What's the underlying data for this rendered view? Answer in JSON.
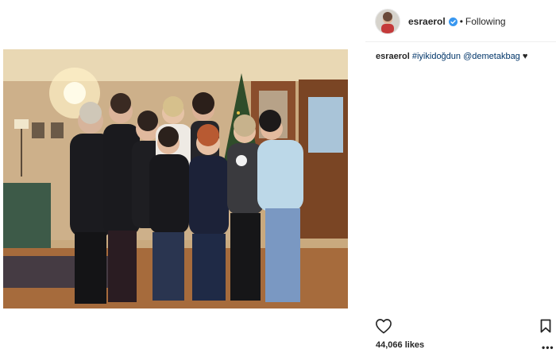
{
  "post": {
    "image_alt": "Group photo of nine women in a living room with a Christmas tree",
    "author": {
      "username": "esraerol",
      "verified": true,
      "follow_status": "Following"
    },
    "caption": {
      "username": "esraerol",
      "hashtag": "#iyikidoğdun",
      "mention": "@demetakbag",
      "emoji": "♥"
    },
    "likes": "44,066 likes"
  },
  "icons": {
    "like": "heart-outline-icon",
    "save": "bookmark-icon",
    "more": "more-options-icon",
    "verified": "verified-badge-icon"
  },
  "colors": {
    "link": "#003569",
    "verified": "#3897f0",
    "text": "#262626",
    "divider": "#efefef"
  }
}
